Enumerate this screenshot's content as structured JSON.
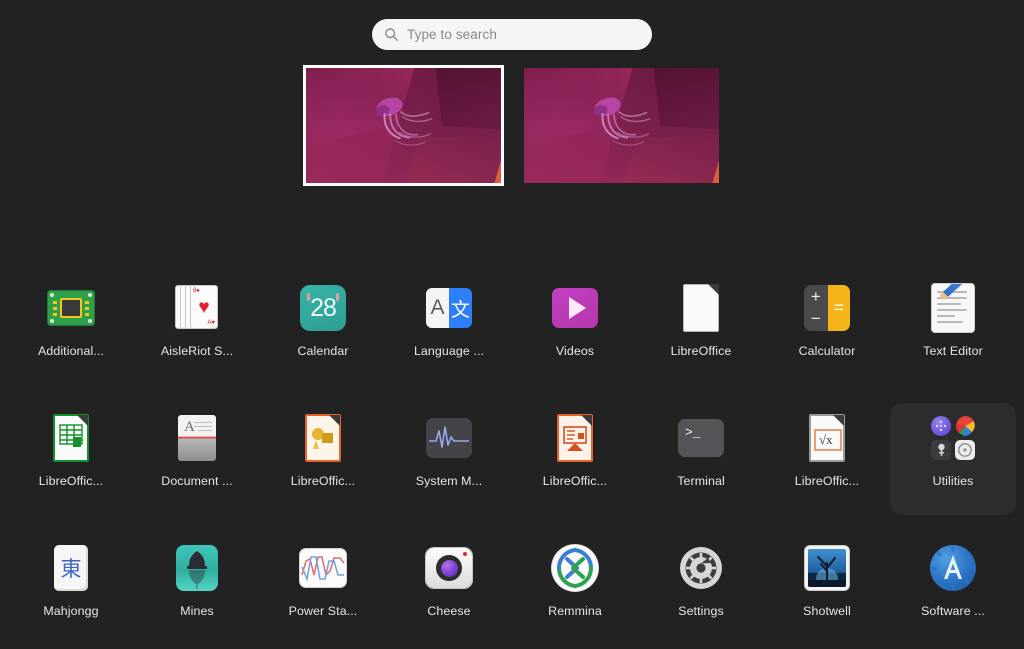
{
  "search": {
    "placeholder": "Type to search",
    "icon": "search-icon"
  },
  "workspaces": {
    "count": 2,
    "items": [
      {
        "name": "workspace-1",
        "selected": true
      },
      {
        "name": "workspace-2",
        "selected": false
      }
    ]
  },
  "app_grid": {
    "columns": 8,
    "rows": [
      [
        {
          "label": "Additional...",
          "icon": "circuit-chip-icon",
          "highlight": false
        },
        {
          "label": "AisleRiot S...",
          "icon": "playing-cards-icon",
          "highlight": false
        },
        {
          "label": "Calendar",
          "icon": "calendar-icon",
          "day": "28",
          "highlight": false
        },
        {
          "label": "Language ...",
          "icon": "translate-icon",
          "highlight": false
        },
        {
          "label": "Videos",
          "icon": "play-button-icon",
          "highlight": false
        },
        {
          "label": "LibreOffice",
          "icon": "document-icon",
          "highlight": false
        },
        {
          "label": "Calculator",
          "icon": "calculator-icon",
          "highlight": false
        },
        {
          "label": "Text Editor",
          "icon": "pencil-document-icon",
          "highlight": false
        }
      ],
      [
        {
          "label": "LibreOffic...",
          "icon": "spreadsheet-icon",
          "highlight": false
        },
        {
          "label": "Document ...",
          "icon": "document-scanner-icon",
          "highlight": false
        },
        {
          "label": "LibreOffic...",
          "icon": "draw-shapes-icon",
          "highlight": false
        },
        {
          "label": "System M...",
          "icon": "waveform-monitor-icon",
          "highlight": false
        },
        {
          "label": "LibreOffic...",
          "icon": "presentation-icon",
          "highlight": false
        },
        {
          "label": "Terminal",
          "icon": "terminal-prompt-icon",
          "prompt": ">_",
          "highlight": false
        },
        {
          "label": "LibreOffic...",
          "icon": "math-formula-icon",
          "highlight": false
        },
        {
          "label": "Utilities",
          "icon": "folder-utilities-icon",
          "highlight": true
        }
      ],
      [
        {
          "label": "Mahjongg",
          "icon": "mahjong-tile-icon",
          "glyph": "東",
          "highlight": false
        },
        {
          "label": "Mines",
          "icon": "minesweeper-icon",
          "highlight": false
        },
        {
          "label": "Power Sta...",
          "icon": "power-graph-icon",
          "highlight": false
        },
        {
          "label": "Cheese",
          "icon": "webcam-icon",
          "highlight": false
        },
        {
          "label": "Remmina",
          "icon": "remote-desktop-icon",
          "highlight": false
        },
        {
          "label": "Settings",
          "icon": "gear-icon",
          "highlight": false
        },
        {
          "label": "Shotwell",
          "icon": "photo-tree-icon",
          "highlight": false
        },
        {
          "label": "Software ...",
          "icon": "software-store-icon",
          "highlight": false
        }
      ]
    ]
  },
  "colors": {
    "background": "#222223",
    "label_text": "#e8e6e3",
    "search_bg": "#f6f5f4",
    "highlight_bg": "#2c2c2e"
  }
}
